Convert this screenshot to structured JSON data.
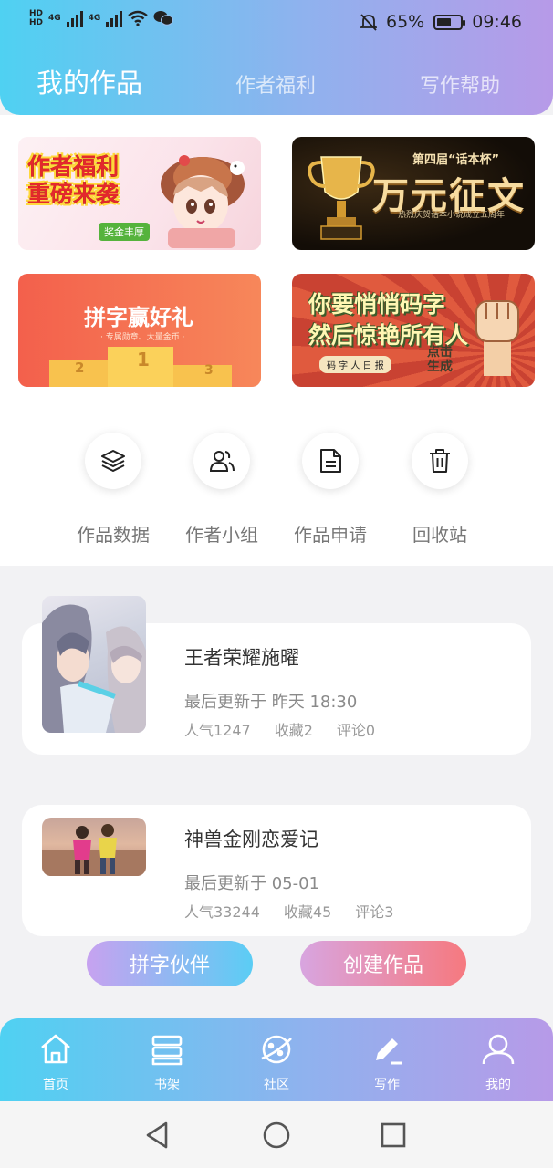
{
  "status_bar": {
    "battery_percent": "65%",
    "time": "09:46",
    "battery_level": 0.65,
    "network_labels": [
      "HD",
      "HD",
      "4G",
      "4G"
    ]
  },
  "header": {
    "tabs": [
      {
        "label": "我的作品",
        "active": true
      },
      {
        "label": "作者福利",
        "active": false
      },
      {
        "label": "写作帮助",
        "active": false
      }
    ]
  },
  "banners": {
    "b1": {
      "title_line1": "作者福利",
      "title_line2": "重磅来袭",
      "badge": "奖金丰厚"
    },
    "b2": {
      "small": "第四届“话本杯”",
      "big": "万元征文",
      "sub": "热烈庆贺话本小说成立五周年"
    },
    "b3": {
      "title": "拼字赢好礼",
      "sub": "· 专属勋章、大量金币 ·",
      "podium": [
        "2",
        "1",
        "3"
      ]
    },
    "b4": {
      "line1": "你要悄悄码字",
      "line2": "然后惊艳所有人",
      "tag": "码 字 人 日 报",
      "click": "点击\n生成"
    }
  },
  "quick_menu": [
    {
      "label": "作品数据",
      "icon": "layers-icon"
    },
    {
      "label": "作者小组",
      "icon": "group-icon"
    },
    {
      "label": "作品申请",
      "icon": "document-icon"
    },
    {
      "label": "回收站",
      "icon": "trash-icon"
    }
  ],
  "works": [
    {
      "title": "王者荣耀施曜",
      "update": "最后更新于 昨天 18:30",
      "popularity": "人气1247",
      "favorites": "收藏2",
      "comments": "评论0"
    },
    {
      "title": "神兽金刚恋爱记",
      "update": "最后更新于 05-01",
      "popularity": "人气33244",
      "favorites": "收藏45",
      "comments": "评论3"
    }
  ],
  "buttons": {
    "partner": "拼字伙伴",
    "create": "创建作品"
  },
  "bottom_nav": [
    {
      "label": "首页",
      "icon": "home-icon"
    },
    {
      "label": "书架",
      "icon": "bookshelf-icon"
    },
    {
      "label": "社区",
      "icon": "planet-icon"
    },
    {
      "label": "写作",
      "icon": "pen-icon"
    },
    {
      "label": "我的",
      "icon": "user-icon"
    }
  ],
  "colors": {
    "gradient_start": "#4fd1f2",
    "gradient_end": "#b79ae8",
    "create_button": "#f6797f",
    "partner_button": "#5bcdf4"
  }
}
